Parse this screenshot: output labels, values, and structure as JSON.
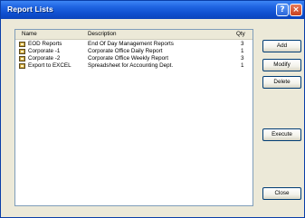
{
  "window": {
    "title": "Report Lists",
    "help_label": "?",
    "close_label": "×"
  },
  "list": {
    "columns": [
      "Name",
      "Description",
      "Qty"
    ],
    "rows": [
      {
        "name": "EOD Reports",
        "description": "End Of Day Management Reports",
        "qty": "3"
      },
      {
        "name": "Corporate -1",
        "description": "Corporate Office Daily Report",
        "qty": "1"
      },
      {
        "name": "Corporate -2",
        "description": "Corporate Office Weekly Report",
        "qty": "3"
      },
      {
        "name": "Export to EXCEL",
        "description": "Spreadsheet for Accounting Dept.",
        "qty": "1"
      }
    ]
  },
  "buttons": {
    "add": "Add",
    "modify": "Modify",
    "delete": "Delete",
    "execute": "Execute",
    "close": "Close"
  }
}
